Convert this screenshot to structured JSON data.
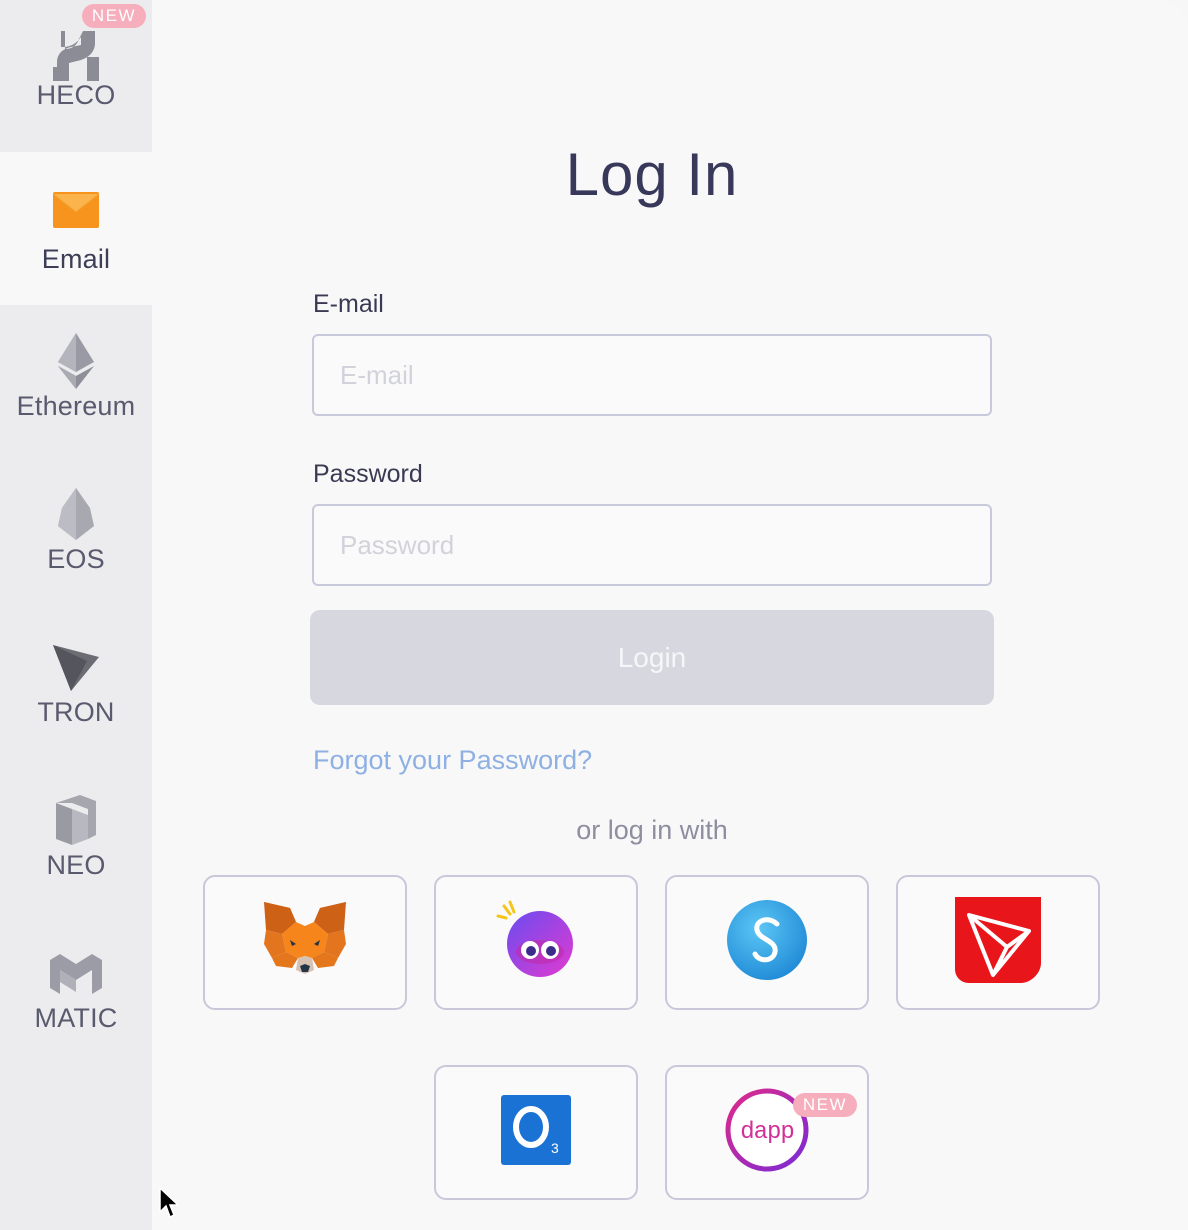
{
  "sidebar": {
    "items": [
      {
        "label": "HECO",
        "icon": "heco-icon",
        "badge": "NEW"
      },
      {
        "label": "Email",
        "icon": "email-icon",
        "active": true
      },
      {
        "label": "Ethereum",
        "icon": "ethereum-icon"
      },
      {
        "label": "EOS",
        "icon": "eos-icon"
      },
      {
        "label": "TRON",
        "icon": "tron-icon"
      },
      {
        "label": "NEO",
        "icon": "neo-icon"
      },
      {
        "label": "MATIC",
        "icon": "matic-icon"
      }
    ]
  },
  "main": {
    "title": "Log In",
    "email_label": "E-mail",
    "email_placeholder": "E-mail",
    "email_value": "",
    "password_label": "Password",
    "password_placeholder": "Password",
    "password_value": "",
    "login_label": "Login",
    "forgot_label": "Forgot your Password?",
    "or_text": "or log in with",
    "wallets": [
      {
        "icon": "metamask-fox-icon"
      },
      {
        "icon": "wallet-eyes-icon"
      },
      {
        "icon": "blue-s-icon"
      },
      {
        "icon": "tronlink-icon"
      },
      {
        "icon": "o3-icon"
      },
      {
        "icon": "dapp-icon",
        "badge": "NEW"
      }
    ]
  },
  "colors": {
    "title": "#38385a",
    "link": "#8fb0e2",
    "button_disabled": "#d7d7e0",
    "badge": "#f6aebc",
    "email_orange": "#f7941d"
  }
}
